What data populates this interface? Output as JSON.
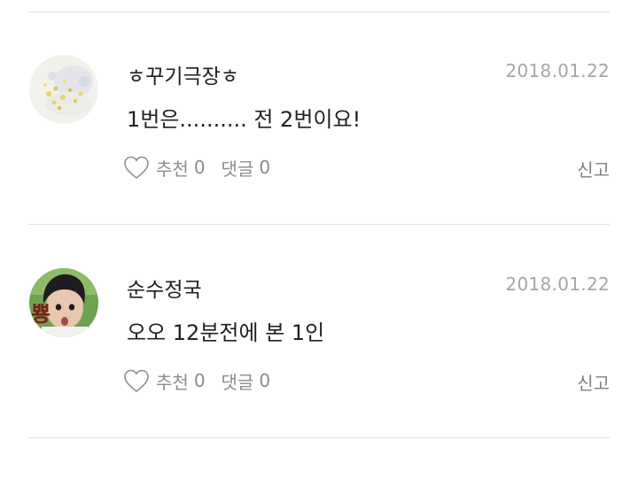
{
  "comments": [
    {
      "username": "ㅎ꾸기극장ㅎ",
      "date": "2018.01.22",
      "text": "1번은.......... 전 2번이요!",
      "like_label": "추천",
      "like_count": "0",
      "reply_label": "댓글",
      "reply_count": "0",
      "report_label": "신고",
      "avatar_icon": "flower-avatar"
    },
    {
      "username": "순수정국",
      "date": "2018.01.22",
      "text": "오오 12분전에 본 1인",
      "like_label": "추천",
      "like_count": "0",
      "reply_label": "댓글",
      "reply_count": "0",
      "report_label": "신고",
      "avatar_icon": "person-avatar",
      "avatar_sticker": "뿅"
    }
  ],
  "colors": {
    "divider": "#e2e2e2",
    "date": "#a6a6a6",
    "action": "#8c8c8c"
  }
}
